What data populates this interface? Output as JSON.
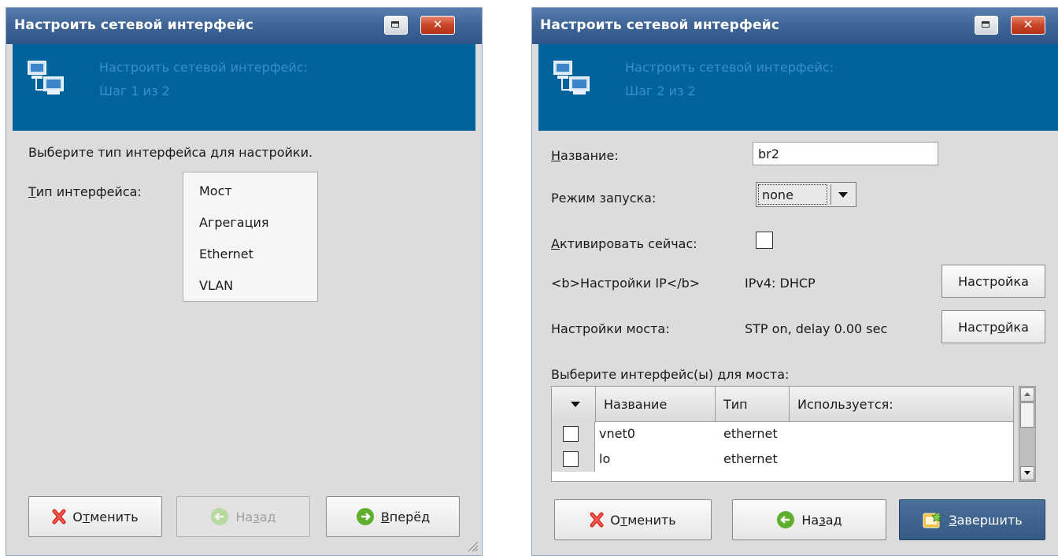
{
  "window1": {
    "title": "Настроить сетевой интерфейс",
    "header_line1": "Настроить сетевой интерфейс:",
    "header_line2": "Шаг 1 из 2",
    "prompt": "Выберите тип интерфейса для настройки.",
    "type_label_underlined": "Т",
    "type_label_rest": "ип интерфейса:",
    "types": [
      "Мост",
      "Агрегация",
      "Ethernet",
      "VLAN"
    ],
    "cancel_pre": "О",
    "cancel_ul": "т",
    "cancel_post": "менить",
    "back_pre": "На",
    "back_ul": "з",
    "back_post": "ад",
    "forward_ul": "В",
    "forward_post": "перёд"
  },
  "window2": {
    "title": "Настроить сетевой интерфейс",
    "header_line1": "Настроить сетевой интерфейс:",
    "header_line2": "Шаг 2 из 2",
    "name_label_ul": "Н",
    "name_label_rest": "азвание:",
    "name_value": "br2",
    "start_mode_label": "Режим запуска:",
    "start_mode_value": "none",
    "activate_label_ul": "А",
    "activate_label_rest": "ктивировать сейчас:",
    "ip_label": "<b>Настройки IP</b>",
    "ip_value": "IPv4: DHCP",
    "ip_button": "Настройка",
    "bridge_label": "Настройки моста:",
    "bridge_value": "STP on, delay 0.00 sec",
    "bridge_button_pre": "Настр",
    "bridge_button_ul": "о",
    "bridge_button_post": "йка",
    "select_prompt": "Выберите интерфейс(ы) для моста:",
    "columns": [
      "Название",
      "Тип",
      "Используется:"
    ],
    "rows": [
      {
        "name": "vnet0",
        "type": "ethernet"
      },
      {
        "name": "lo",
        "type": "ethernet"
      }
    ],
    "cancel_pre": "О",
    "cancel_ul": "т",
    "cancel_post": "менить",
    "back_pre": "На",
    "back_ul": "з",
    "back_post": "ад",
    "finish_ul": "З",
    "finish_post": "авершить"
  },
  "colors": {
    "titlebar": "#3f6697",
    "header_bg": "#00639c",
    "header_text": "#3c8dc8",
    "window_bg": "#dcdcdc",
    "primary_button": "#355a83"
  },
  "icons": [
    "network-computers-icon",
    "cancel-x-icon",
    "back-arrow-icon",
    "forward-arrow-icon",
    "finish-icon",
    "resize-grip-icon"
  ]
}
